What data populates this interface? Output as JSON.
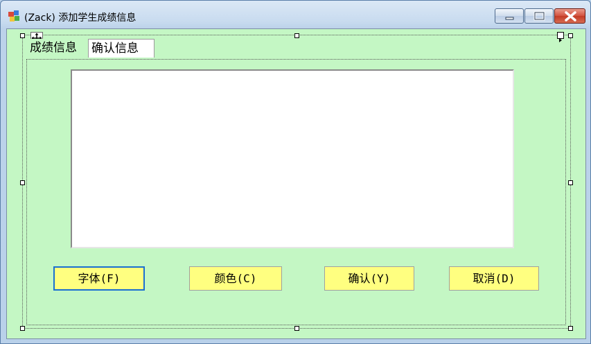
{
  "window": {
    "title": "(Zack) 添加学生成绩信息",
    "icons": {
      "app": "app-icon",
      "minimize": "minimize-icon",
      "maximize": "maximize-icon",
      "close": "close-icon"
    }
  },
  "tabs": [
    {
      "label": "成绩信息",
      "active": false
    },
    {
      "label": "确认信息",
      "active": true
    }
  ],
  "memo": {
    "value": ""
  },
  "buttons": {
    "font": "字体(F)",
    "color": "颜色(C)",
    "confirm": "确认(Y)",
    "cancel": "取消(D)"
  },
  "colors": {
    "client_bg": "#c4f7c4",
    "button_bg": "#ffff80",
    "focus_border": "#1a6fd1",
    "close_button": "#c33b25"
  }
}
